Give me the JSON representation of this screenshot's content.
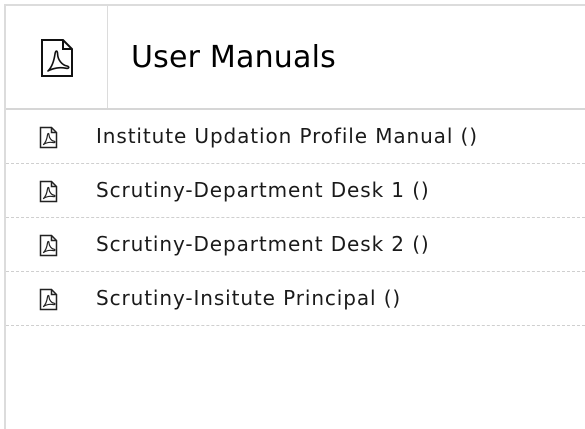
{
  "header": {
    "icon": "pdf-icon",
    "title": "User Manuals"
  },
  "manuals": [
    {
      "icon": "pdf-icon",
      "label": "Institute Updation Profile Manual ()"
    },
    {
      "icon": "pdf-icon",
      "label": "Scrutiny-Department Desk 1 ()"
    },
    {
      "icon": "pdf-icon",
      "label": "Scrutiny-Department Desk 2 ()"
    },
    {
      "icon": "pdf-icon",
      "label": "Scrutiny-Insitute Principal ()"
    },
    {
      "icon": "pdf-icon",
      "label": ""
    }
  ],
  "colors": {
    "border": "#dcdcdc",
    "divider": "#cfcfcf",
    "text": "#1a1a1a"
  }
}
